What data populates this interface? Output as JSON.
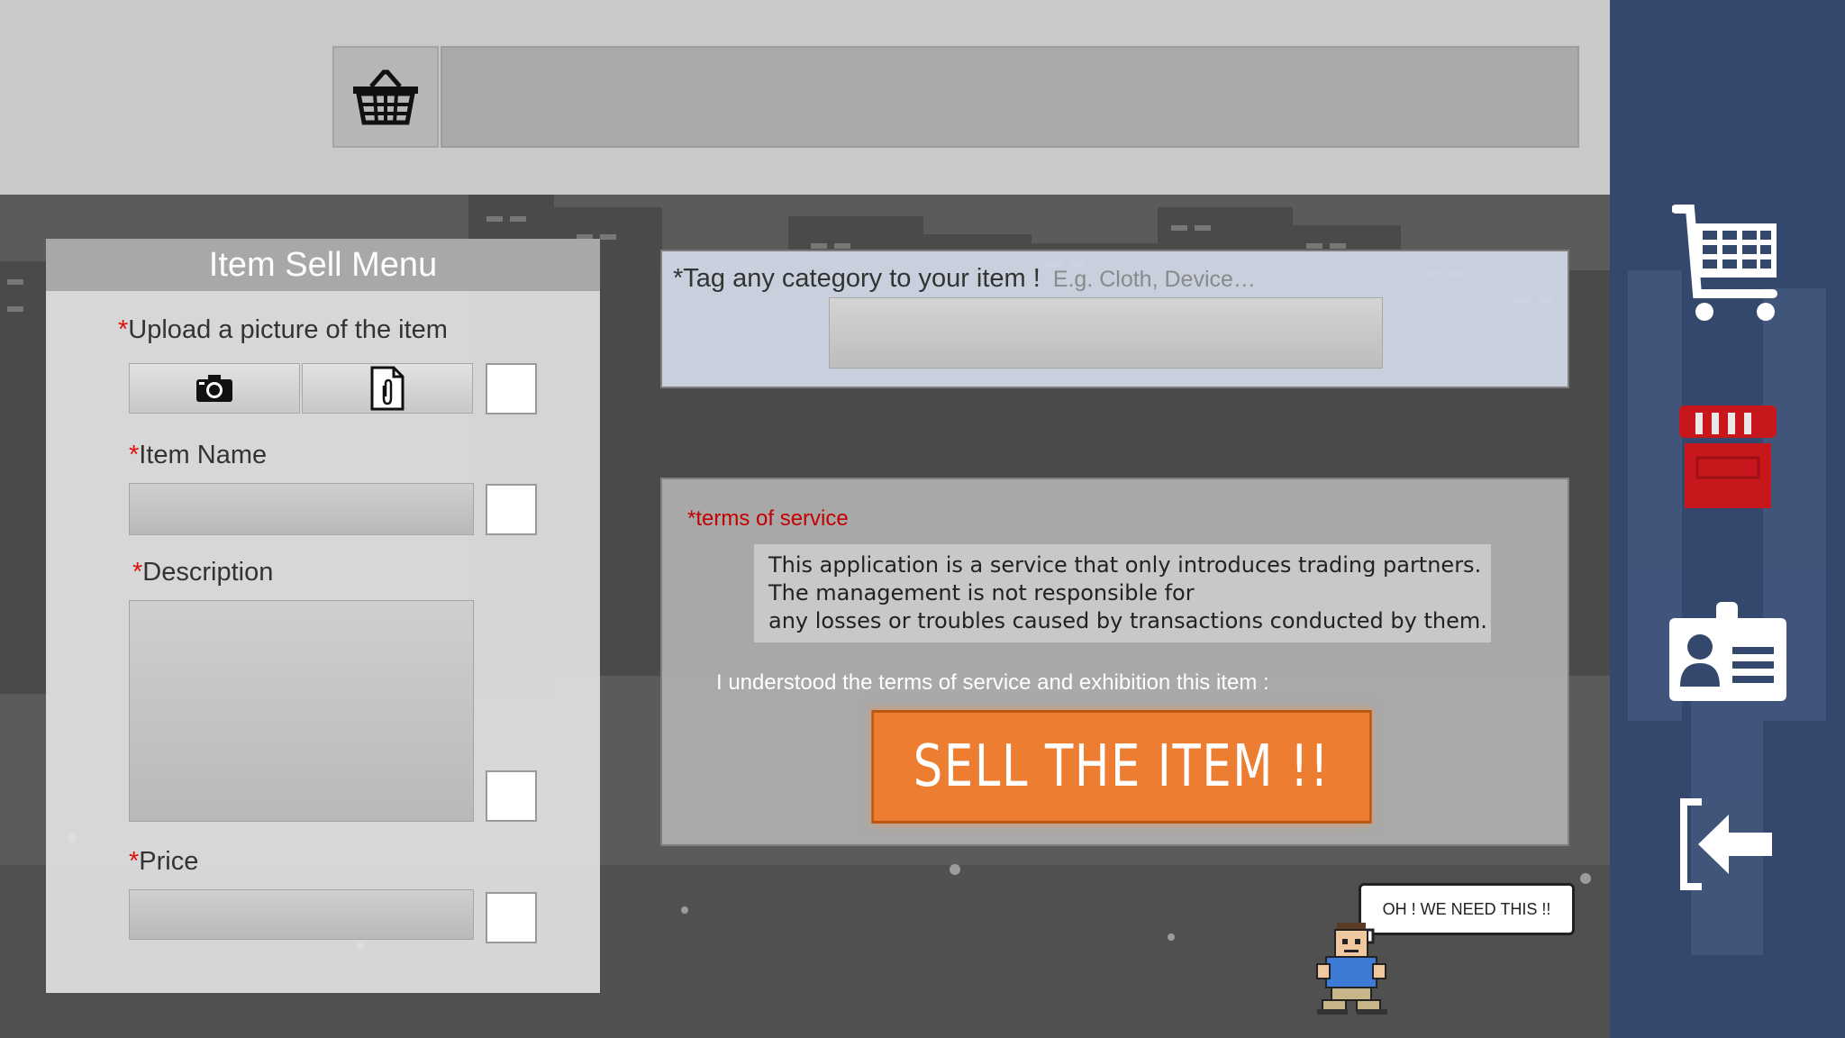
{
  "header": {
    "basket_icon": "basket-icon",
    "search_value": ""
  },
  "sidebar": {
    "items": [
      {
        "icon": "cart-icon",
        "active": false
      },
      {
        "icon": "store-icon",
        "active": true
      },
      {
        "icon": "profile-card-icon",
        "active": false
      },
      {
        "icon": "logout-icon",
        "active": false
      }
    ],
    "active_color": "#c8161d"
  },
  "sell_menu": {
    "title": "Item Sell Menu",
    "required_mark": "*",
    "upload_label": "Upload a picture of the item",
    "upload_buttons": [
      "camera-icon",
      "file-attach-icon"
    ],
    "item_name_label": "Item Name",
    "item_name_value": "",
    "description_label": "Description",
    "description_value": "",
    "price_label": "Price",
    "price_value": ""
  },
  "tag": {
    "label": "*Tag any category to your item !",
    "hint": "E.g. Cloth, Device…",
    "value": ""
  },
  "terms": {
    "title": "*terms of service",
    "text_lines": [
      "This application is a service that only introduces trading partners.",
      "The management is not responsible for",
      "any losses or troubles caused by transactions conducted by them."
    ],
    "understand": "I understood the terms of service and exhibition this item :",
    "sell_button": "SELL THE ITEM !!"
  },
  "mascot": {
    "speech": "OH ! WE NEED THIS !!"
  },
  "colors": {
    "accent_orange": "#ed7d31",
    "sidebar_bg": "#34476d",
    "required_red": "#d11111"
  }
}
